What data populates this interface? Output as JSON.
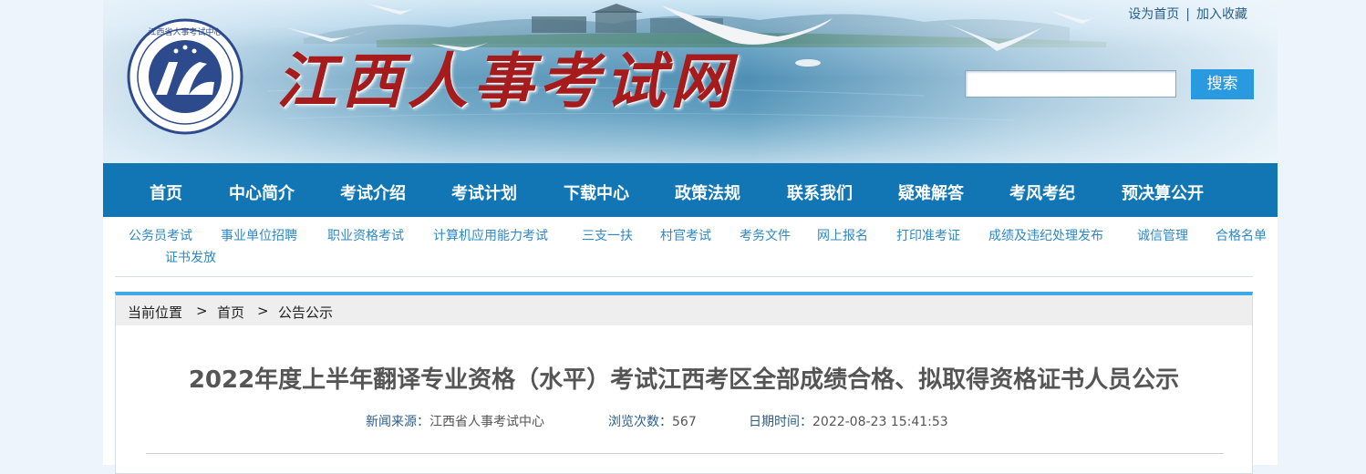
{
  "header": {
    "site_title": "江西人事考试网",
    "top_links": [
      "设为首页",
      "加入收藏"
    ],
    "top_links_separator": "|",
    "search": {
      "placeholder": "",
      "button_label": "搜索"
    },
    "logo_text": "江西省人事考试中心"
  },
  "main_nav": [
    "首页",
    "中心简介",
    "考试介绍",
    "考试计划",
    "下载中心",
    "政策法规",
    "联系我们",
    "疑难解答",
    "考风考纪",
    "预决算公开"
  ],
  "sub_nav": [
    "公务员考试",
    "事业单位招聘",
    "职业资格考试",
    "计算机应用能力考试",
    "三支一扶",
    "村官考试",
    "考务文件",
    "网上报名",
    "打印准考证",
    "成绩及违纪处理发布",
    "诚信管理",
    "合格名单",
    "证书发放"
  ],
  "breadcrumb": {
    "label": "当前位置",
    "separator": ">",
    "items": [
      "首页",
      "公告公示"
    ]
  },
  "article": {
    "title": "2022年度上半年翻译专业资格（水平）考试江西考区全部成绩合格、拟取得资格证书人员公示",
    "source_label": "新闻来源：",
    "source": "江西省人事考试中心",
    "views_label": "浏览次数：",
    "views": "567",
    "date_label": "日期时间：",
    "date": "2022-08-23 15:41:53"
  },
  "colors": {
    "nav_bg": "#1276b5",
    "accent_blue": "#3fa9e6",
    "title_red": "#a61c1c",
    "search_button": "#2a9ae0"
  }
}
